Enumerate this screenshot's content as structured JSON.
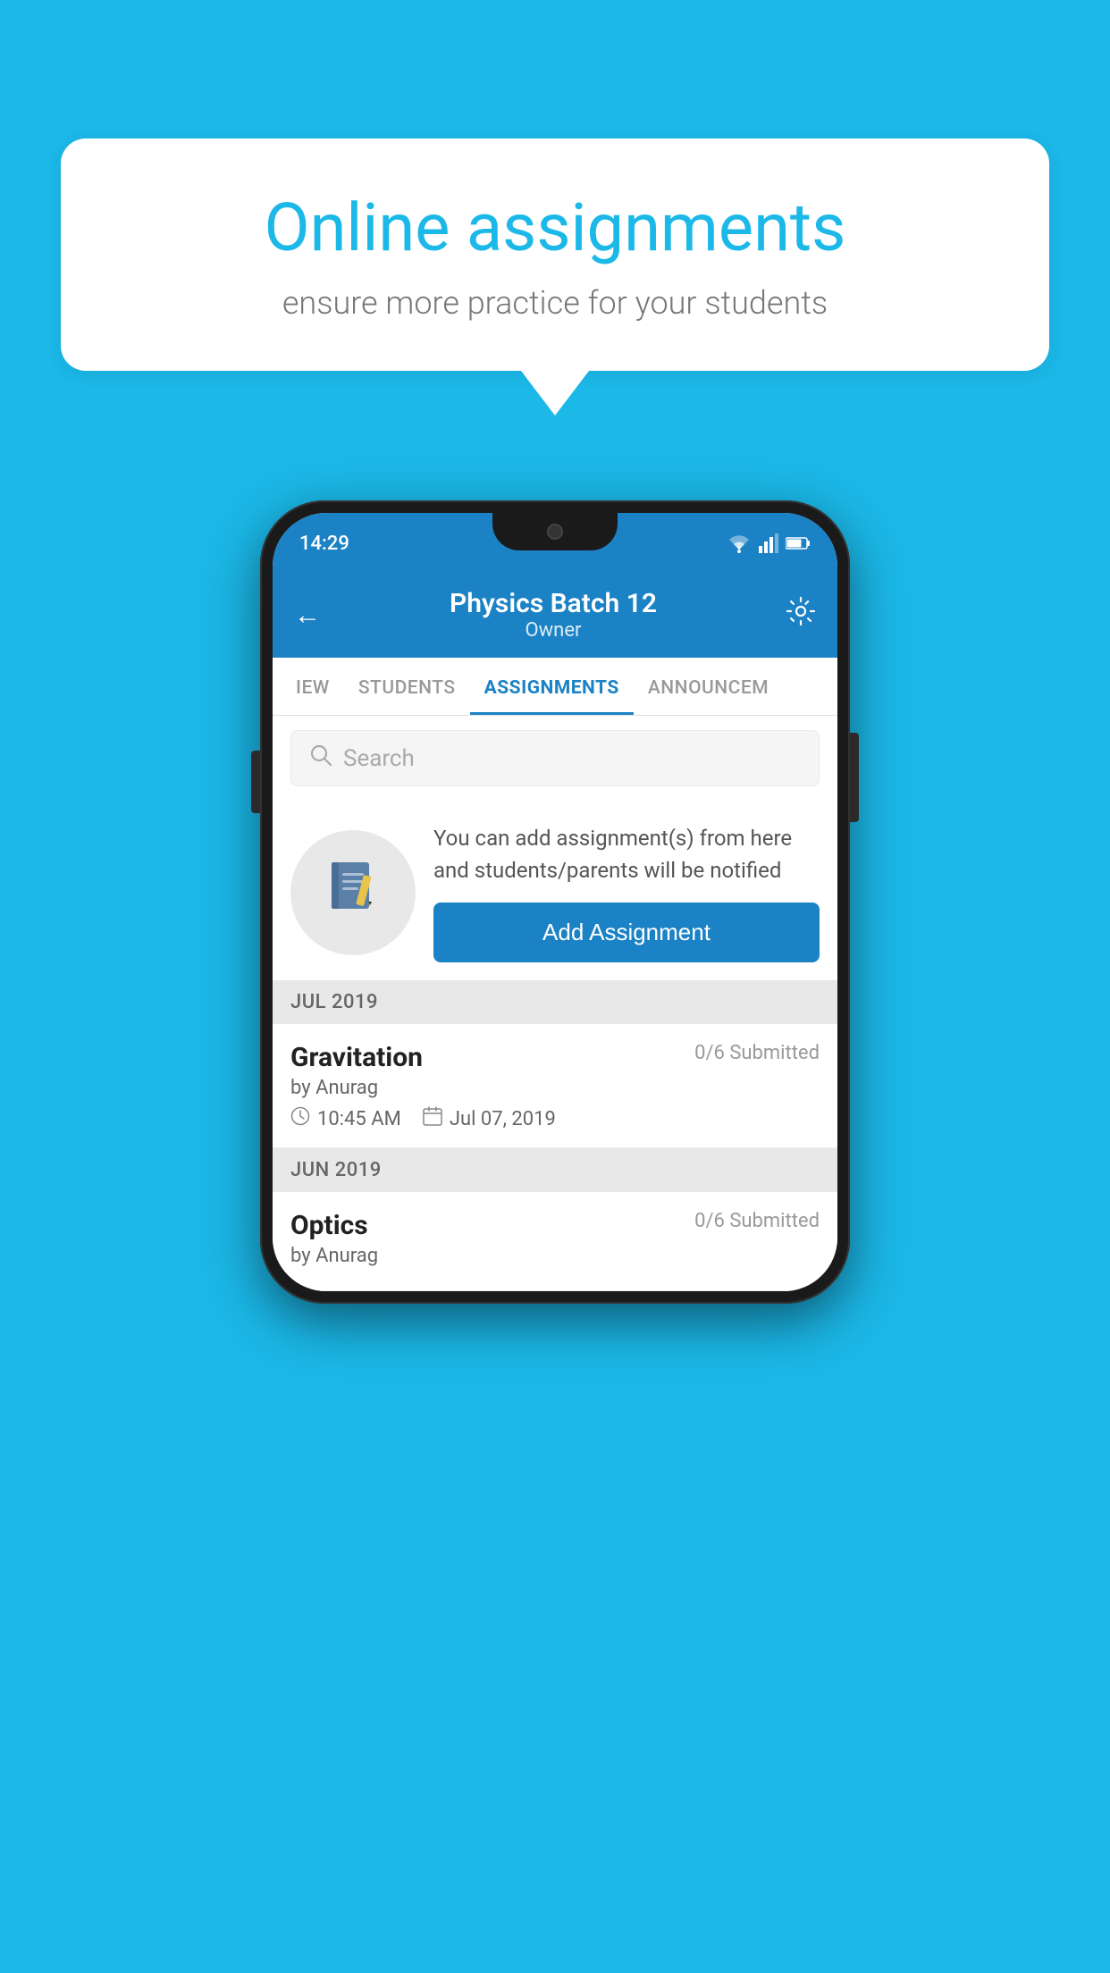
{
  "background_color": "#1BB8E8",
  "speech_bubble": {
    "title": "Online assignments",
    "subtitle": "ensure more practice for your students"
  },
  "status_bar": {
    "time": "14:29",
    "wifi_icon": "wifi",
    "signal_icon": "signal",
    "battery_icon": "battery"
  },
  "header": {
    "back_label": "←",
    "title": "Physics Batch 12",
    "subtitle": "Owner",
    "settings_icon": "gear"
  },
  "tabs": [
    {
      "label": "IEW",
      "active": false
    },
    {
      "label": "STUDENTS",
      "active": false
    },
    {
      "label": "ASSIGNMENTS",
      "active": true
    },
    {
      "label": "ANNOUNCEM",
      "active": false
    }
  ],
  "search": {
    "placeholder": "Search"
  },
  "info_section": {
    "description": "You can add assignment(s) from here and students/parents will be notified",
    "add_button_label": "Add Assignment"
  },
  "assignments": [
    {
      "section": "JUL 2019",
      "title": "Gravitation",
      "submitted": "0/6 Submitted",
      "author": "by Anurag",
      "time": "10:45 AM",
      "date": "Jul 07, 2019"
    },
    {
      "section": "JUN 2019",
      "title": "Optics",
      "submitted": "0/6 Submitted",
      "author": "by Anurag",
      "time": "",
      "date": ""
    }
  ]
}
